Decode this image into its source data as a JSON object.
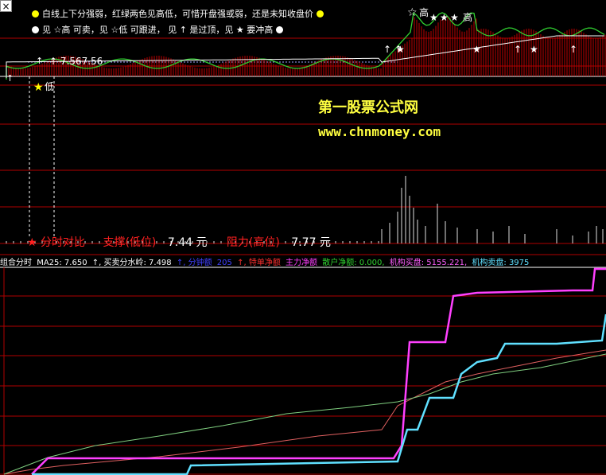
{
  "window": {
    "close_glyph": "×"
  },
  "legend": {
    "line1_text": "白线上下分强弱，红绿两色见高低，可惜开盘强或弱，还是未知收盘价",
    "line2_text": "见 ☆高 可卖，见 ☆低 可跟进，  见 ↑ 是过顶，见 ★ 要冲高",
    "dot_color_yellow": "#ffff00",
    "dot_color_white": "#ffffff"
  },
  "watermark": {
    "title": "第一股票公式网",
    "url": "www.chnmoney.com"
  },
  "price_label": "↑ 7.567.56",
  "chart_marks": {
    "high_label": "高",
    "low_label": "低",
    "arrow_glyph": "↑",
    "star_glyph": "★",
    "star_outline_glyph": "☆"
  },
  "bottom_row": {
    "compare_label": "分时对比",
    "support_label": "支撑(低位)",
    "support_value": "7.44 元",
    "resist_label": "阻力(高位)",
    "resist_value": "7.77 元"
  },
  "stats": {
    "combo": "组合分时",
    "ma25": "MA25: 7.650",
    "watershed": "↑, 买卖分水岭: 7.498",
    "minute_amt": "↑, 分钟额",
    "minute_val": "205",
    "special": "↑, 特单净额",
    "main_net": "主力净额",
    "retail_net": "散户净额: 0.000,",
    "inst_buy": "机构买盘: 5155.221,",
    "inst_sell": "机构卖盘: 3975"
  },
  "colors": {
    "grid_red": "#b00000",
    "yellow": "#ffff00",
    "red_text": "#ff3030",
    "blue": "#4040ff",
    "green": "#30d030",
    "magenta": "#ff40ff",
    "cyan": "#60e0ff",
    "pink": "#ff60ff"
  }
}
